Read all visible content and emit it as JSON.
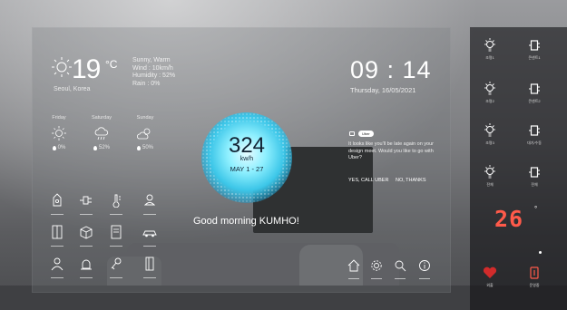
{
  "weather": {
    "temperature": "19",
    "unit": "°C",
    "location": "Seoul, Korea",
    "details": [
      "Sunny, Warm",
      "Wind : 10km/h",
      "Humidity : 52%",
      "Rain : 0%"
    ],
    "icon": "sun-icon"
  },
  "forecast": [
    {
      "day": "Friday",
      "icon": "sun-icon",
      "rain": "0%"
    },
    {
      "day": "Saturday",
      "icon": "rain-cloud-icon",
      "rain": "52%"
    },
    {
      "day": "Sunday",
      "icon": "partly-cloudy-icon",
      "rain": "50%"
    }
  ],
  "energy": {
    "value": "324",
    "unit": "kw/h",
    "range": "MAY 1 - 27",
    "accent": "#3cc6e8"
  },
  "greeting": "Good morning KUMHO!",
  "clock": {
    "time": "09 : 14",
    "date": "Thursday, 16/05/2021"
  },
  "message": {
    "sender": "Uber",
    "text": "It looks like you'll be late again on your design meet. Would you like to go with Uber?",
    "accept": "YES, CALL UBER",
    "decline": "NO, THANKS"
  },
  "quick_grid_icons": [
    "doorbell-icon",
    "plug-icon",
    "thermometer-icon",
    "robot-icon",
    "fridge-icon",
    "box-icon",
    "document-icon",
    "car-icon",
    "person-icon",
    "alarm-icon",
    "key-icon",
    "door-icon"
  ],
  "bottom_nav_icons": [
    "home-icon",
    "settings-icon",
    "search-icon",
    "info-icon"
  ],
  "right_panel": {
    "devices": [
      {
        "label": "조명1",
        "icon": "bulb-icon"
      },
      {
        "label": "콘센트1",
        "icon": "outlet-icon"
      },
      {
        "label": "조명2",
        "icon": "bulb-icon"
      },
      {
        "label": "콘센트2",
        "icon": "outlet-icon"
      },
      {
        "label": "조명3",
        "icon": "bulb-icon"
      },
      {
        "label": "대기/수동",
        "icon": "outlet-icon"
      },
      {
        "label": "전체",
        "icon": "bulb-icon"
      },
      {
        "label": "전체",
        "icon": "outlet-icon"
      }
    ],
    "room_temp": "26",
    "room_temp_unit": "°",
    "bottom": [
      {
        "label": "외출",
        "icon": "heart-icon"
      },
      {
        "label": "운영중",
        "icon": "power-icon"
      }
    ],
    "temp_color": "#ff5a4a"
  }
}
